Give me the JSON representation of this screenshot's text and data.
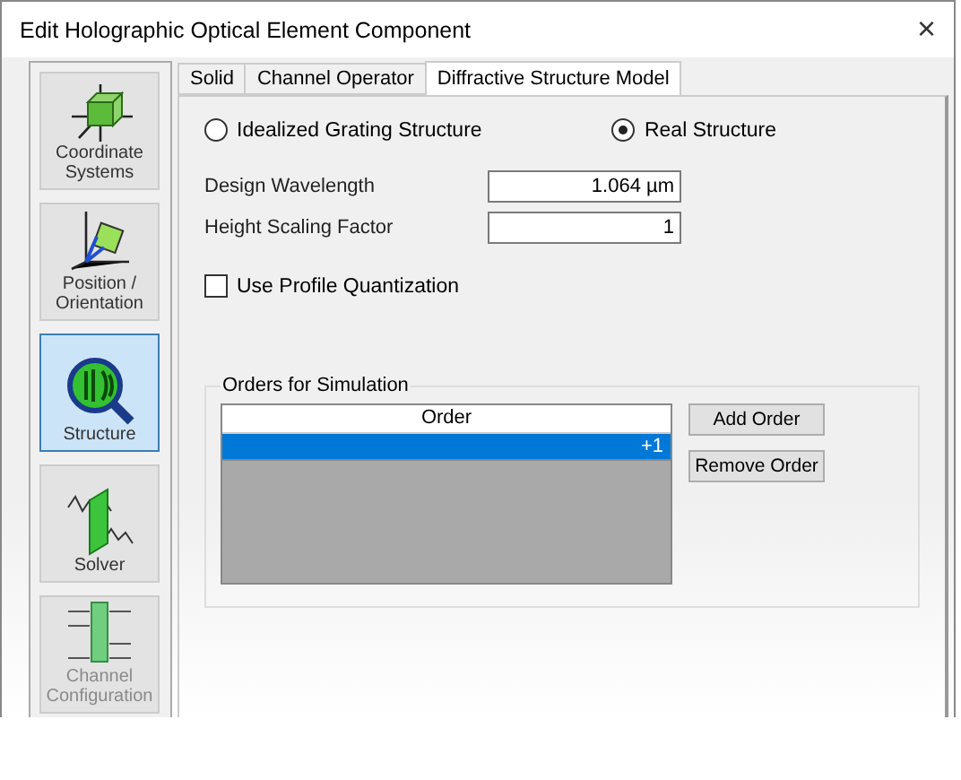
{
  "window": {
    "title": "Edit Holographic Optical Element Component",
    "close": "×"
  },
  "sidebar": {
    "items": [
      {
        "kind": "axes",
        "label": "Coordinate Systems",
        "selected": false,
        "disabled": false
      },
      {
        "kind": "position",
        "label": "Position / Orientation",
        "selected": false,
        "disabled": false
      },
      {
        "kind": "structure",
        "label": "Structure",
        "selected": true,
        "disabled": false
      },
      {
        "kind": "solver",
        "label": "Solver",
        "selected": false,
        "disabled": false
      },
      {
        "kind": "channel",
        "label": "Channel Configuration",
        "selected": false,
        "disabled": true
      }
    ]
  },
  "tabs": [
    {
      "label": "Solid",
      "selected": false
    },
    {
      "label": "Channel Operator",
      "selected": false
    },
    {
      "label": "Diffractive Structure Model",
      "selected": true
    }
  ],
  "structure_options": [
    {
      "label": "Idealized Grating Structure",
      "selected": false
    },
    {
      "label": "Real Structure",
      "selected": true
    }
  ],
  "fields": [
    {
      "label": "Design Wavelength",
      "value": "1.064 µm"
    },
    {
      "label": "Height Scaling Factor",
      "value": "1"
    }
  ],
  "quantization": {
    "label": "Use Profile Quantization",
    "checked": false
  },
  "orders": {
    "title": "Orders for Simulation",
    "column": "Order",
    "rows": [
      {
        "value": "+1",
        "selected": true
      }
    ],
    "buttons": [
      "Add Order",
      "Remove Order"
    ]
  }
}
